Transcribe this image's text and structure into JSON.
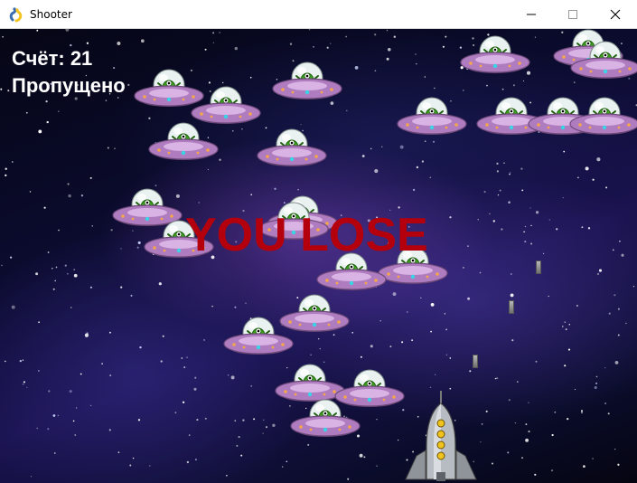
{
  "window": {
    "title": "Shooter",
    "app_icon": "pygame-snake-icon",
    "controls": [
      "minimize-icon",
      "maximize-icon",
      "close-icon"
    ]
  },
  "hud": {
    "score_text": "Счёт: 21",
    "missed_text": "Пропущено"
  },
  "game_over_text": "YOU LOSE",
  "colors": {
    "game_over": "#b4000d",
    "hud_text": "#ffffff",
    "ufo_body": "#b07cc0",
    "alien": "#3aa51a"
  },
  "sprites": {
    "enemy": "ufo-icon",
    "player": "rocket-icon",
    "projectile": "bullet"
  }
}
